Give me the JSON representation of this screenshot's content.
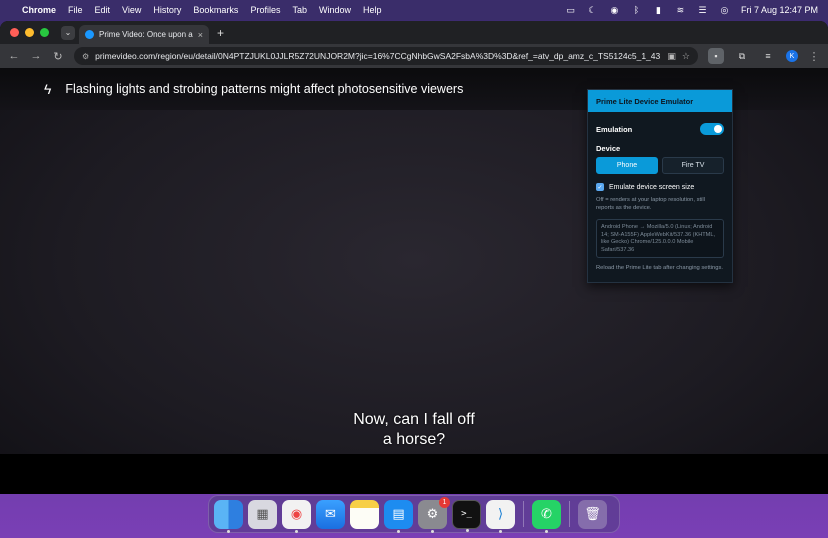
{
  "menubar": {
    "app_name": "Chrome",
    "items": [
      "File",
      "Edit",
      "View",
      "History",
      "Bookmarks",
      "Profiles",
      "Tab",
      "Window",
      "Help"
    ],
    "datetime": "Fri 7 Aug  12:47 PM"
  },
  "browser": {
    "tab_title": "Prime Video: Once upon a Tim",
    "tab_close": "×",
    "new_tab": "+",
    "url": "primevideo.com/region/eu/detail/0N4PTZJUKL0JJLR5Z72UNJOR2M?jic=16%7CCgNhbGwSA2FsbA%3D%3D&ref_=atv_dp_amz_c_TS5124c5_1_43",
    "profile_initial": "K"
  },
  "page": {
    "warning_text": "Flashing lights and strobing patterns might affect photosensitive viewers",
    "subtitle_line1": "Now, can I fall off",
    "subtitle_line2": "a horse?"
  },
  "popup": {
    "title": "Prime Lite Device Emulator",
    "emulation_label": "Emulation",
    "emulation_on": true,
    "device_label": "Device",
    "devices": [
      "Phone",
      "Fire TV"
    ],
    "selected_device": "Phone",
    "emulate_screen_label": "Emulate device screen size",
    "emulate_screen_checked": true,
    "emulate_screen_hint": "Off = renders at your laptop resolution, still reports as the device.",
    "user_agent": "Android Phone → Mozilla/5.0 (Linux; Android 14; SM-A155F) AppleWebKit/537.36 (KHTML, like Gecko) Chrome/125.0.0.0 Mobile Safari/537.36",
    "reload_hint": "Reload the Prime Lite tab after changing settings."
  },
  "dock": {
    "apps": [
      "finder",
      "launchpad",
      "chrome",
      "mail",
      "notes",
      "docker",
      "system-settings",
      "terminal",
      "vscode",
      "whatsapp",
      "trash"
    ],
    "settings_badge": "1"
  }
}
